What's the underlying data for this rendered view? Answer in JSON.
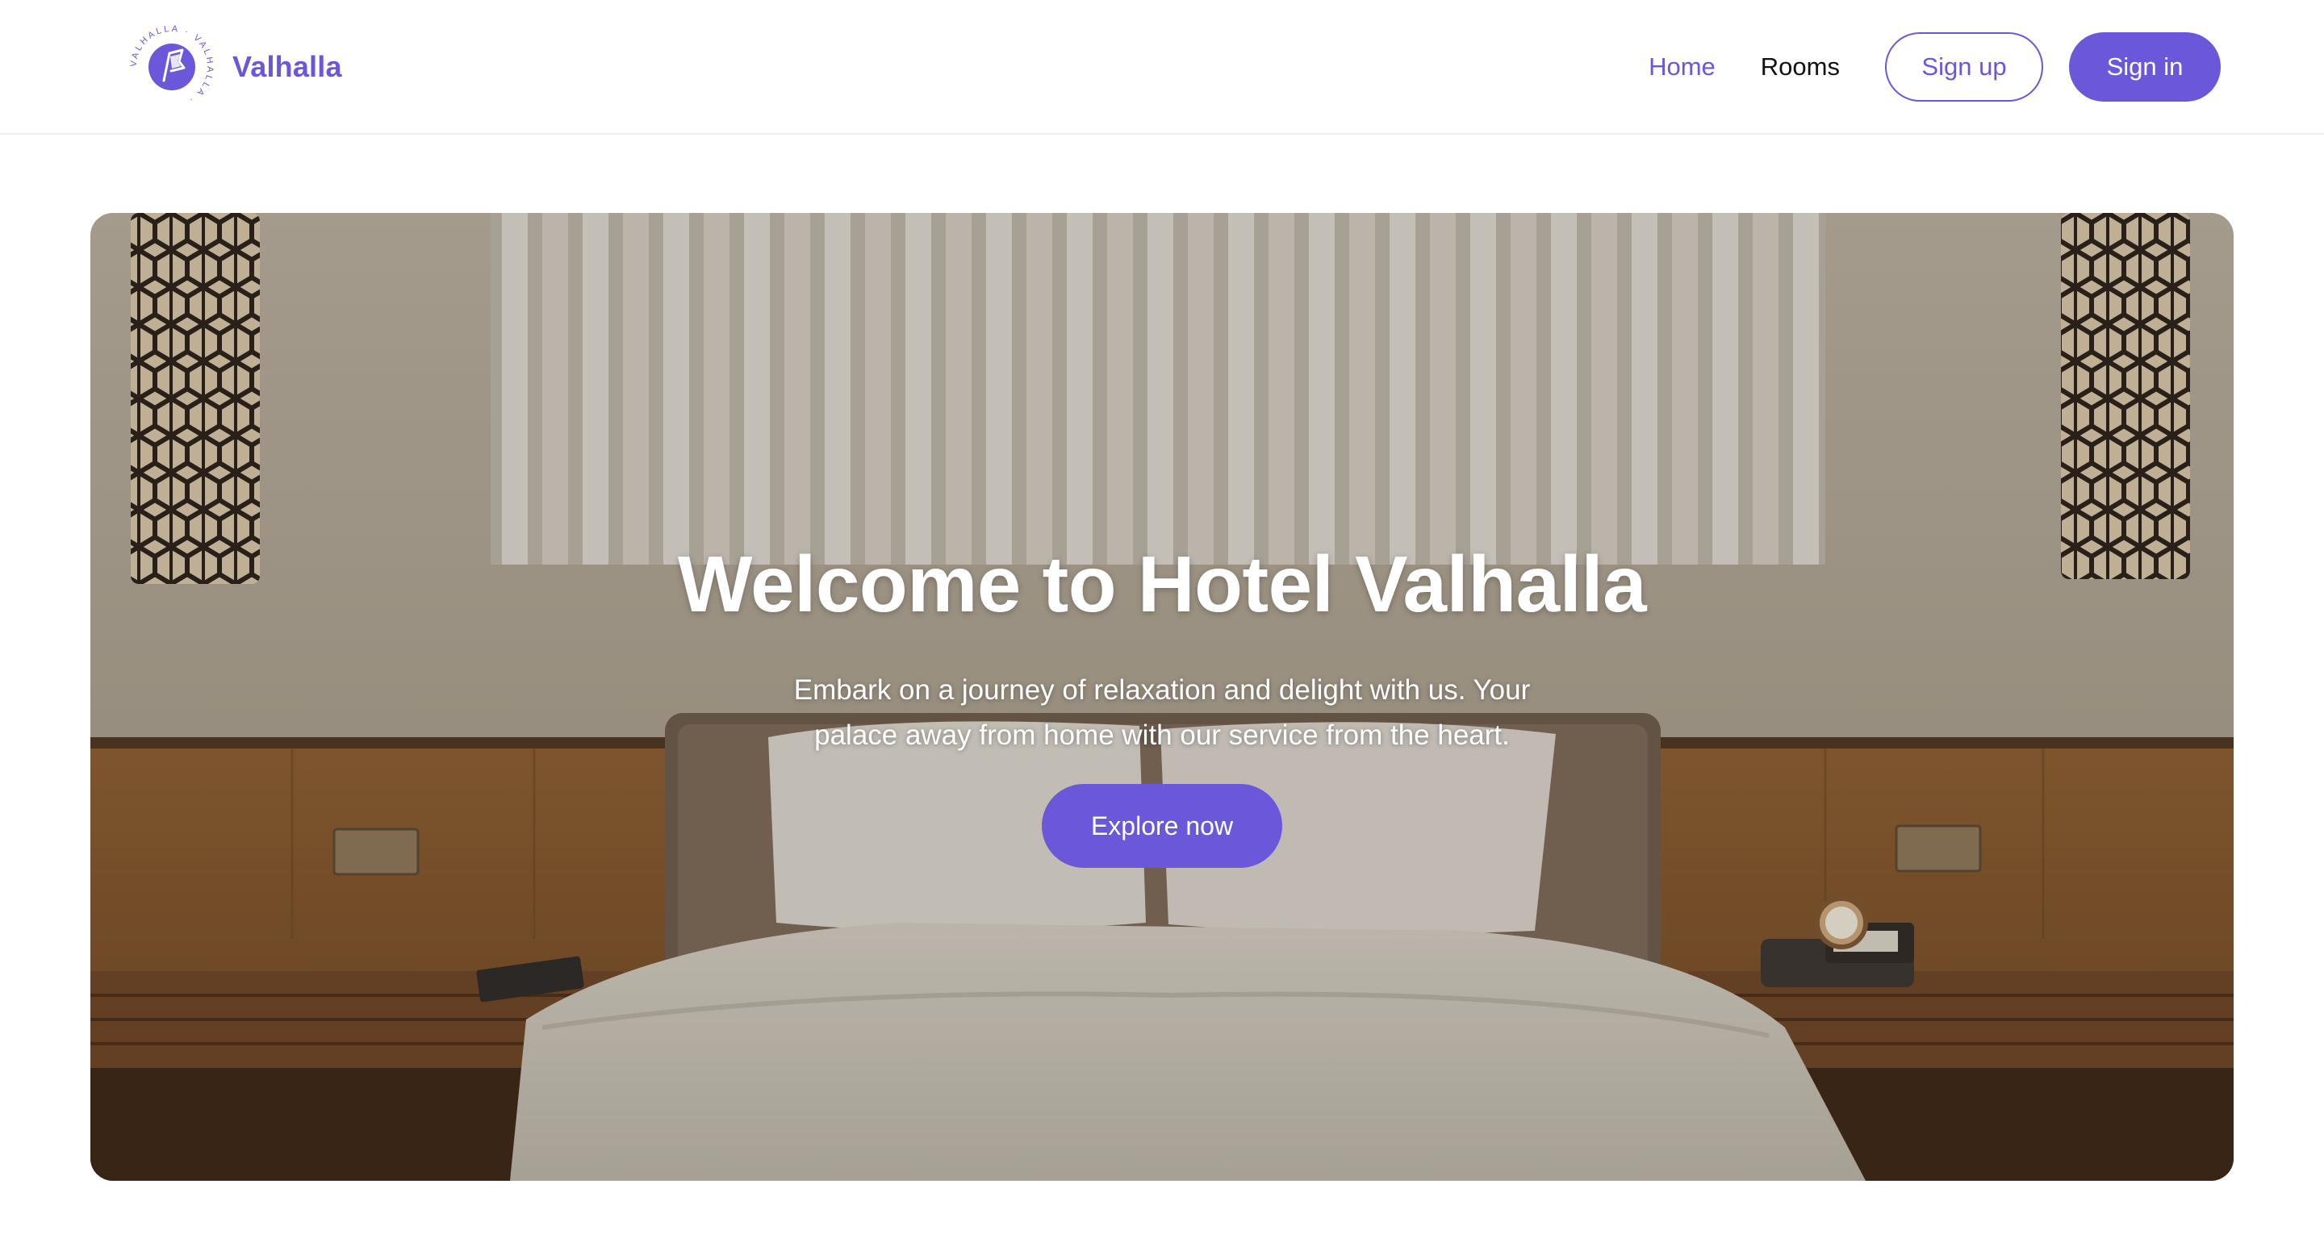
{
  "brand": {
    "name": "Valhalla",
    "logo_ring_text": "VALHALLA · VALHALLA ·",
    "logo_icon": "flag-emblem-icon"
  },
  "nav": {
    "links": [
      {
        "label": "Home",
        "active": true
      },
      {
        "label": "Rooms",
        "active": false
      }
    ],
    "signup_label": "Sign up",
    "signin_label": "Sign in"
  },
  "hero": {
    "title": "Welcome to Hotel Valhalla",
    "subtitle": "Embark on a journey of relaxation and delight with us. Your palace away from home with our service from the heart.",
    "cta_label": "Explore now"
  },
  "colors": {
    "accent": "#6b57d9",
    "nav_text": "#111111",
    "background": "#ffffff"
  }
}
